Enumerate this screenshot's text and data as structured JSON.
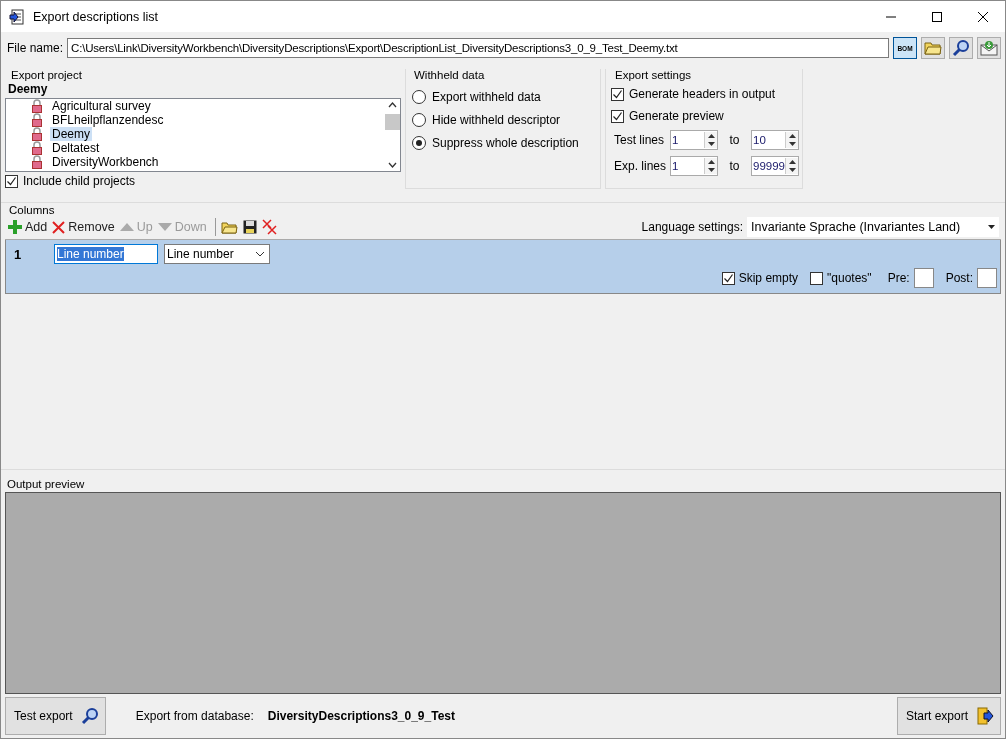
{
  "window": {
    "title": "Export descriptions list"
  },
  "file_name": {
    "label": "File name:",
    "value": "C:\\Users\\Link\\DiversityWorkbench\\DiversityDescriptions\\Export\\DescriptionList_DiversityDescriptions3_0_9_Test_Deemy.txt"
  },
  "file_buttons": [
    {
      "kind": "bom",
      "label": "BOM",
      "selected": true
    },
    {
      "kind": "folder",
      "selected": false
    },
    {
      "kind": "search",
      "selected": false
    },
    {
      "kind": "mail",
      "selected": false
    }
  ],
  "export_project": {
    "title": "Export project",
    "current": "Deemy",
    "projects": [
      {
        "label": "Agricultural survey",
        "selected": false
      },
      {
        "label": "BFLheilpflanzendesc",
        "selected": false
      },
      {
        "label": "Deemy",
        "selected": true
      },
      {
        "label": "Deltatest",
        "selected": false
      },
      {
        "label": "DiversityWorkbench",
        "selected": false
      }
    ],
    "include_child": {
      "label": "Include child projects",
      "checked": true
    }
  },
  "withheld": {
    "title": "Withheld data",
    "options": [
      {
        "label": "Export withheld data",
        "selected": false
      },
      {
        "label": "Hide withheld descriptor",
        "selected": false
      },
      {
        "label": "Suppress whole description",
        "selected": true
      }
    ]
  },
  "export_settings": {
    "title": "Export settings",
    "checks": [
      {
        "label": "Generate headers in output",
        "checked": true
      },
      {
        "label": "Generate preview",
        "checked": true
      }
    ],
    "ranges": [
      {
        "label": "Test lines",
        "from": "1",
        "to_label": "to",
        "to": "10"
      },
      {
        "label": "Exp. lines",
        "from": "1",
        "to_label": "to",
        "to": "99999"
      }
    ]
  },
  "columns": {
    "title": "Columns",
    "toolbar": [
      {
        "kind": "add",
        "label": "Add",
        "disabled": false
      },
      {
        "kind": "remove",
        "label": "Remove",
        "disabled": false
      },
      {
        "kind": "up",
        "label": "Up",
        "disabled": true
      },
      {
        "kind": "down",
        "label": "Down",
        "disabled": true
      },
      {
        "kind": "open",
        "disabled": false
      },
      {
        "kind": "save",
        "disabled": false
      },
      {
        "kind": "clear",
        "disabled": false
      }
    ],
    "language": {
      "label": "Language settings:",
      "value": "Invariante Sprache (Invariantes Land)"
    },
    "rows": [
      {
        "number": "1",
        "name": "Line number",
        "source": "Line number",
        "skip_empty": {
          "label": "Skip empty",
          "checked": true
        },
        "quotes": {
          "label": "\"quotes\"",
          "checked": false
        },
        "pre": "Pre:",
        "post": "Post:"
      }
    ]
  },
  "output_preview": {
    "title": "Output preview"
  },
  "footer": {
    "test_button": "Test export",
    "db_label": "Export from database:",
    "db_name": "DiversityDescriptions3_0_9_Test",
    "start_button": "Start export"
  }
}
